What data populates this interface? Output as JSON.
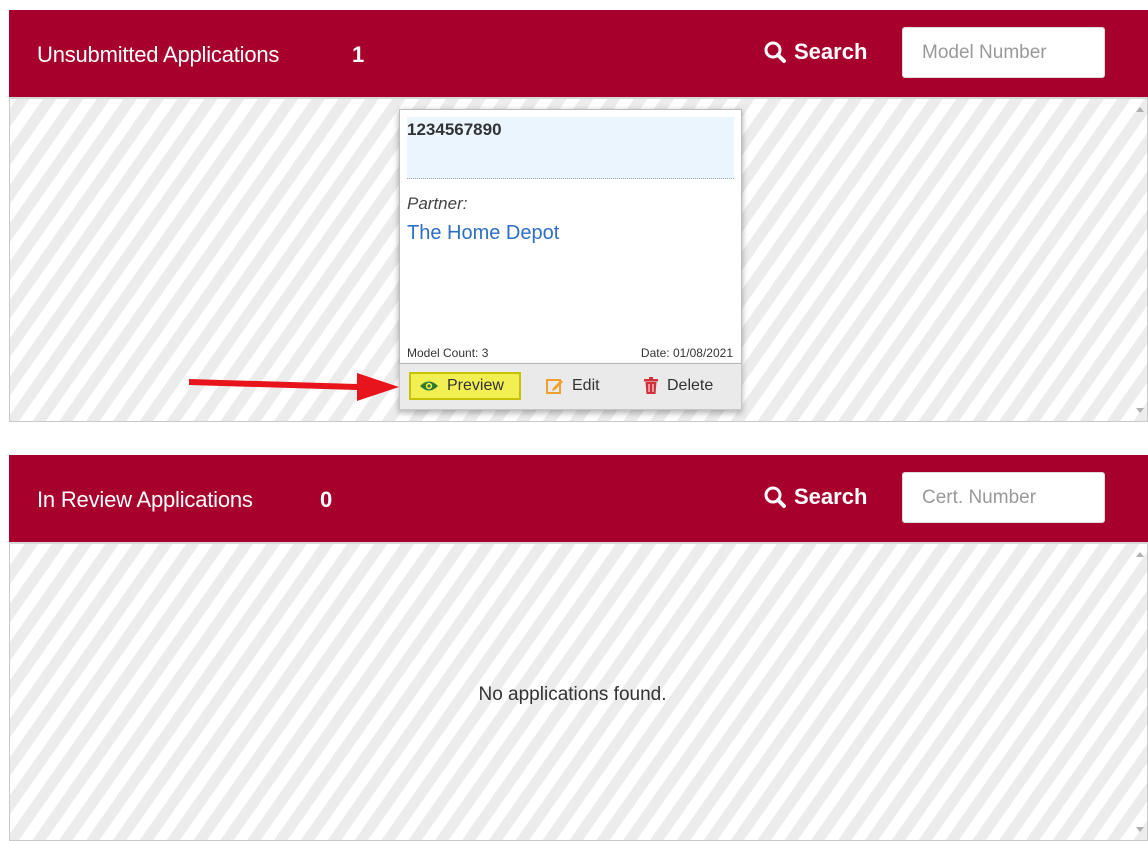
{
  "unsubmitted": {
    "title": "Unsubmitted Applications",
    "count": "1",
    "search_label": "Search",
    "search_placeholder": "Model Number",
    "cards": [
      {
        "id": "1234567890",
        "partner_label": "Partner:",
        "partner_name": "The Home Depot",
        "model_count": "Model Count: 3",
        "date": "Date: 01/08/2021",
        "actions": {
          "preview": "Preview",
          "edit": "Edit",
          "delete": "Delete"
        }
      }
    ]
  },
  "in_review": {
    "title": "In Review Applications",
    "count": "0",
    "search_label": "Search",
    "search_placeholder": "Cert. Number",
    "empty_message": "No applications found."
  },
  "colors": {
    "header_bg": "#a8002d",
    "link": "#2e6fc4",
    "highlight": "#f1ef52",
    "annotation_arrow": "#e8141b"
  },
  "icons": {
    "search": "search-icon",
    "preview": "eye-icon",
    "edit": "edit-icon",
    "delete": "trash-icon"
  }
}
